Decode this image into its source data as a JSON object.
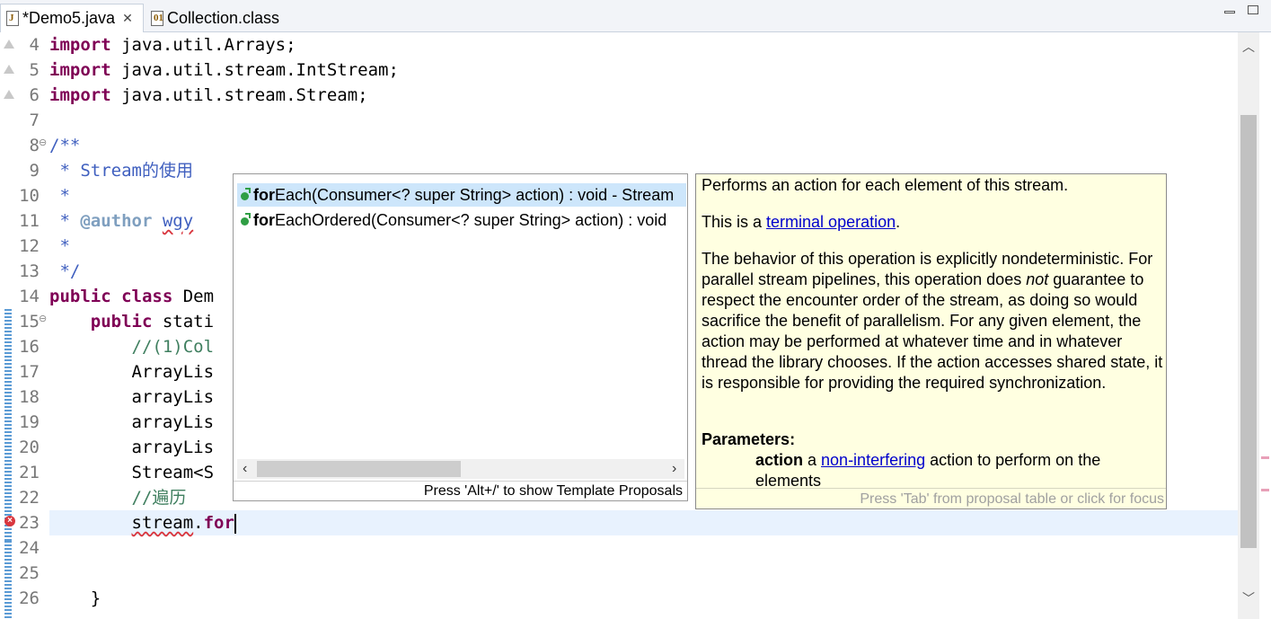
{
  "tabs": [
    {
      "label": "*Demo5.java",
      "icon": "java-file-icon",
      "active": true,
      "close": "✕"
    },
    {
      "label": "Collection.class",
      "icon": "class-file-icon",
      "active": false
    }
  ],
  "code": {
    "lines": [
      {
        "n": "4",
        "text": "import java.util.Arrays;"
      },
      {
        "n": "5",
        "text": "import java.util.stream.IntStream;"
      },
      {
        "n": "6",
        "text": "import java.util.stream.Stream;"
      },
      {
        "n": "7",
        "text": ""
      },
      {
        "n": "8",
        "text": "/**"
      },
      {
        "n": "9",
        "text": " * Stream的使用"
      },
      {
        "n": "10",
        "text": " *"
      },
      {
        "n": "11",
        "text": " * @author wgy"
      },
      {
        "n": "12",
        "text": " *"
      },
      {
        "n": "13",
        "text": " */"
      },
      {
        "n": "14",
        "text": "public class Dem"
      },
      {
        "n": "15",
        "text": "    public stati"
      },
      {
        "n": "16",
        "text": "        //(1)Col"
      },
      {
        "n": "17",
        "text": "        ArrayLis"
      },
      {
        "n": "18",
        "text": "        arrayLis"
      },
      {
        "n": "19",
        "text": "        arrayLis"
      },
      {
        "n": "20",
        "text": "        arrayLis"
      },
      {
        "n": "21",
        "text": "        Stream<S"
      },
      {
        "n": "22",
        "text": "        //遍历"
      },
      {
        "n": "23",
        "text": "        stream.for"
      },
      {
        "n": "24",
        "text": ""
      },
      {
        "n": "25",
        "text": ""
      },
      {
        "n": "26",
        "text": "    }"
      }
    ]
  },
  "autocomplete": {
    "proposals": [
      {
        "bold": "for",
        "rest": "Each(Consumer<? super String> action) : void - Stream"
      },
      {
        "bold": "for",
        "rest": "EachOrdered(Consumer<? super String> action) : void"
      }
    ],
    "footer": "Press 'Alt+/' to show Template Proposals"
  },
  "javadoc": {
    "p1": "Performs an action for each element of this stream.",
    "p2_pre": "This is a ",
    "p2_link": "terminal operation",
    "p2_post": ".",
    "p3a": "The behavior of this operation is explicitly nondeterministic. For parallel stream pipelines, this operation does ",
    "p3_em": "not",
    "p3b": " guarantee to respect the encounter order of the stream, as doing so would sacrifice the benefit of parallelism. For any given element, the action may be performed at whatever time and in whatever thread the library chooses. If the action accesses shared state, it is responsible for providing the required synchronization.",
    "params_label": "Parameters:",
    "param_name": "action",
    "param_pre": " a ",
    "param_link": "non-interfering",
    "param_post": " action to perform on the elements",
    "footer": "Press 'Tab' from proposal table or click for focus"
  },
  "colors": {
    "keyword": "#7f0055",
    "comment": "#3f7f5f",
    "javadoc": "#3f5fbf",
    "selection": "#cde6fb",
    "doc_bg": "#ffffe1"
  }
}
